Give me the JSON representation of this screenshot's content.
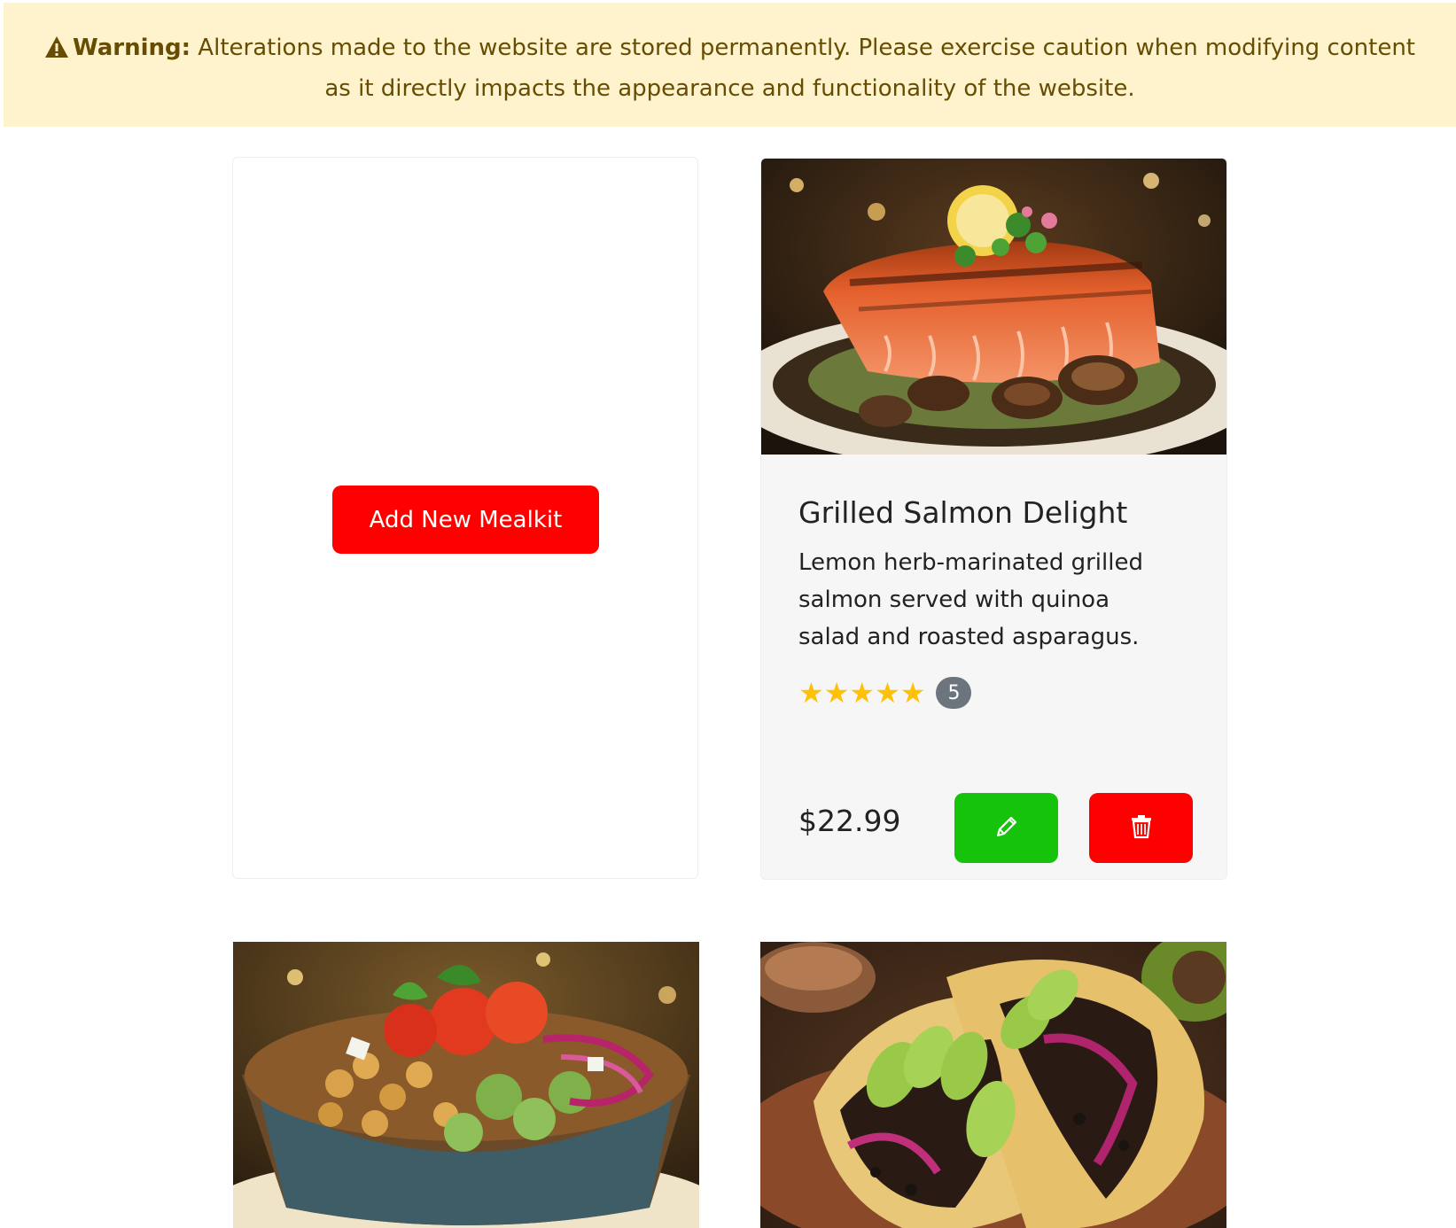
{
  "alert": {
    "label": "Warning:",
    "message": " Alterations made to the website are stored permanently. Please exercise caution when modifying content as it directly impacts the appearance and functionality of the website.",
    "icon": "warning-triangle-icon"
  },
  "add_card": {
    "button_label": "Add New Mealkit"
  },
  "meal": {
    "title": "Grilled Salmon Delight",
    "description": "Lemon herb-marinated grilled salmon served with quinoa salad and roasted asparagus.",
    "rating_stars": 5,
    "review_count": "5",
    "price": "$22.99",
    "edit_icon": "pencil-icon",
    "delete_icon": "trash-icon"
  },
  "colors": {
    "alert_bg": "#fff3cd",
    "alert_text": "#664d03",
    "danger": "#ff0000",
    "success": "#14c30a",
    "star": "#ffc107",
    "badge": "#6c757d"
  }
}
